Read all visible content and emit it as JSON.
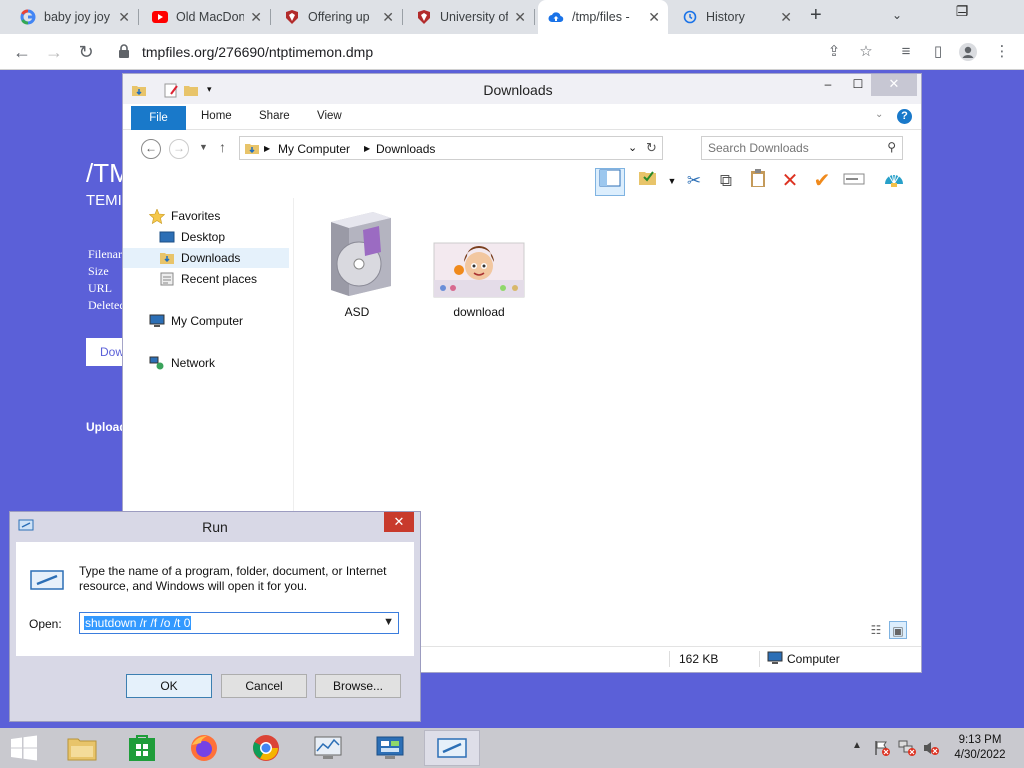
{
  "browser": {
    "tabs": [
      {
        "title": "baby joy joy",
        "icon": "google-icon"
      },
      {
        "title": "Old MacDon",
        "icon": "youtube-icon"
      },
      {
        "title": "Offering up",
        "icon": "pitt-icon"
      },
      {
        "title": "University of",
        "icon": "pitt-icon"
      },
      {
        "title": "/tmp/files -",
        "icon": "cloud-upload-icon",
        "active": true
      },
      {
        "title": "History",
        "icon": "history-icon"
      }
    ],
    "url": "tmpfiles.org/276690/ntptimemon.dmp"
  },
  "page": {
    "title": "/TM",
    "subtitle": "TEMI",
    "fields": [
      "Filenar",
      "Size",
      "URL",
      "Deleted"
    ],
    "download_button": "Dow",
    "upload_label": "Upload"
  },
  "explorer": {
    "title": "Downloads",
    "ribbon_tabs": [
      "File",
      "Home",
      "Share",
      "View"
    ],
    "breadcrumb": [
      "My Computer",
      "Downloads"
    ],
    "search_placeholder": "Search Downloads",
    "nav": {
      "favorites": "Favorites",
      "desktop": "Desktop",
      "downloads": "Downloads",
      "recent": "Recent places",
      "computer": "My Computer",
      "network": "Network"
    },
    "files": [
      {
        "name": "ASD"
      },
      {
        "name": "download"
      }
    ],
    "status": {
      "size": "162 KB",
      "location": "Computer"
    }
  },
  "run": {
    "title": "Run",
    "description": "Type the name of a program, folder, document, or Internet resource, and Windows will open it for you.",
    "open_label": "Open:",
    "command": "shutdown /r /f /o /t 0",
    "ok": "OK",
    "cancel": "Cancel",
    "browse": "Browse..."
  },
  "taskbar": {
    "time": "9:13 PM",
    "date": "4/30/2022"
  },
  "colors": {
    "page_bg": "#5b60d8",
    "ribbon_blue": "#1979ca",
    "close_red": "#c83a2c"
  }
}
